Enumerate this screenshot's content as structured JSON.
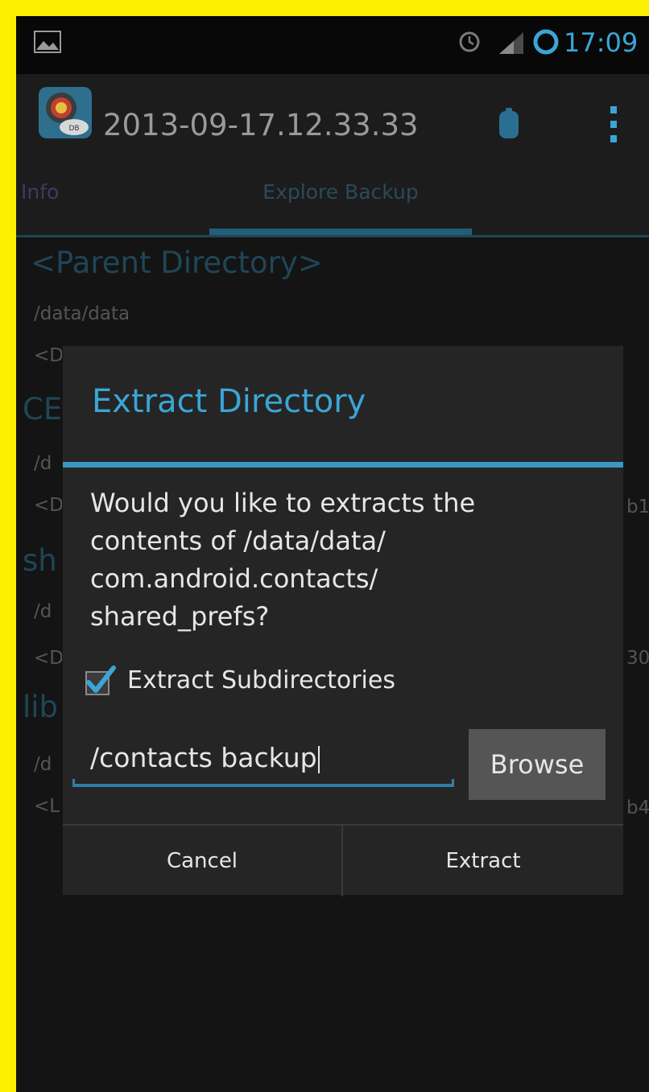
{
  "status_bar": {
    "time": "17:09",
    "icons": [
      "gallery-icon",
      "alarm-icon",
      "signal-icon",
      "sync-icon"
    ]
  },
  "action_bar": {
    "title": "2013-09-17.12.33.33",
    "icons": [
      "app-icon",
      "bookmark-icon",
      "overflow-menu-icon"
    ]
  },
  "tabs": [
    {
      "label": "Info",
      "selected": false
    },
    {
      "label": "Explore Backup",
      "selected": true
    }
  ],
  "background_list": {
    "heading_1": "<Parent Directory>",
    "path_1": "/data/data",
    "type_1": "<DIR>",
    "heading_2_fragment": "CE",
    "path_2_fragment": "/d",
    "type_2_fragment": "<D",
    "heading_3_fragment": "sh",
    "path_3_fragment": "/d",
    "type_3_fragment": "<D",
    "heading_4_fragment": "lib",
    "path_4_fragment": "/d",
    "type_4_fragment": "<L",
    "right_fragment_1": "b1",
    "right_fragment_2": "30",
    "right_fragment_3": "b4"
  },
  "dialog": {
    "title": "Extract Directory",
    "message": "Would you like to extracts the\ncontents of /data/data/\ncom.android.contacts/\nshared_prefs?",
    "checkbox_label": "Extract Subdirectories",
    "checkbox_checked": true,
    "path_value": "/contacts backup",
    "browse_label": "Browse",
    "cancel_label": "Cancel",
    "extract_label": "Extract"
  },
  "colors": {
    "frame": "#fcf000",
    "accent": "#3aa6d6",
    "background": "#141414",
    "dialog": "#252525"
  }
}
